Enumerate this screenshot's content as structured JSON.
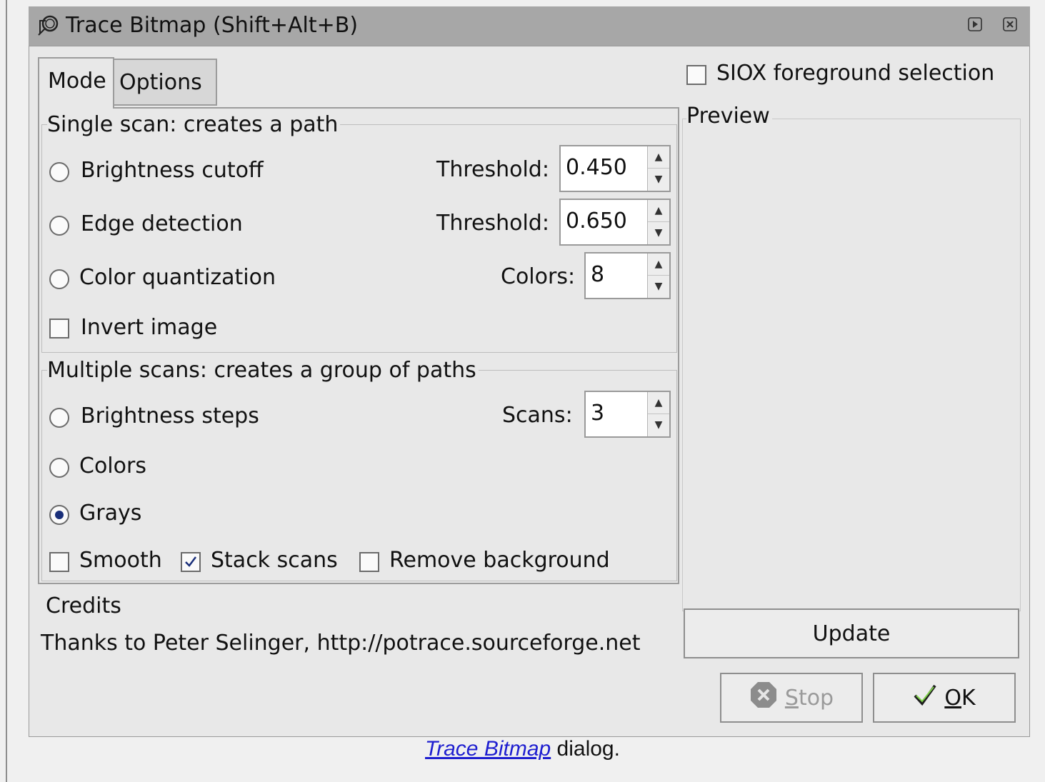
{
  "window": {
    "title": "Trace Bitmap (Shift+Alt+B)",
    "icons": [
      "trace-bitmap-icon",
      "roll-up-icon",
      "close-icon"
    ]
  },
  "tabs": [
    {
      "label": "Mode",
      "active": true
    },
    {
      "label": "Options",
      "active": false
    }
  ],
  "single_scan": {
    "title": "Single scan: creates a path",
    "brightness": {
      "label": "Brightness cutoff",
      "threshold_label": "Threshold:",
      "value": "0.450",
      "selected": false
    },
    "edge": {
      "label": "Edge detection",
      "threshold_label": "Threshold:",
      "value": "0.650",
      "selected": false
    },
    "color": {
      "label": "Color quantization",
      "colors_label": "Colors:",
      "value": "8",
      "selected": false
    },
    "invert": {
      "label": "Invert image",
      "checked": false
    }
  },
  "multi_scan": {
    "title": "Multiple scans: creates a group of paths",
    "brightness_steps": {
      "label": "Brightness steps",
      "scans_label": "Scans:",
      "value": "3",
      "selected": false
    },
    "colors": {
      "label": "Colors",
      "selected": false
    },
    "grays": {
      "label": "Grays",
      "selected": true
    },
    "smooth": {
      "label": "Smooth",
      "checked": false
    },
    "stack": {
      "label": "Stack scans",
      "checked": true
    },
    "remove_bg": {
      "label": "Remove background",
      "checked": false
    }
  },
  "credits": {
    "title": "Credits",
    "text": "Thanks to Peter Selinger, http://potrace.sourceforge.net"
  },
  "siox": {
    "label": "SIOX foreground selection",
    "checked": false
  },
  "preview": {
    "title": "Preview",
    "update_label": "Update"
  },
  "buttons": {
    "stop": {
      "label_prefix": "",
      "mnemonic": "S",
      "label_rest": "top",
      "enabled": false
    },
    "ok": {
      "mnemonic": "O",
      "label_rest": "K",
      "enabled": true
    }
  },
  "caption": {
    "link": "Trace Bitmap",
    "rest": " dialog."
  },
  "colors": {
    "titlebar": "#a7a7a7",
    "panel": "#e8e8e8",
    "radio_dot": "#1a2f7a",
    "link": "#1f1fd0"
  }
}
